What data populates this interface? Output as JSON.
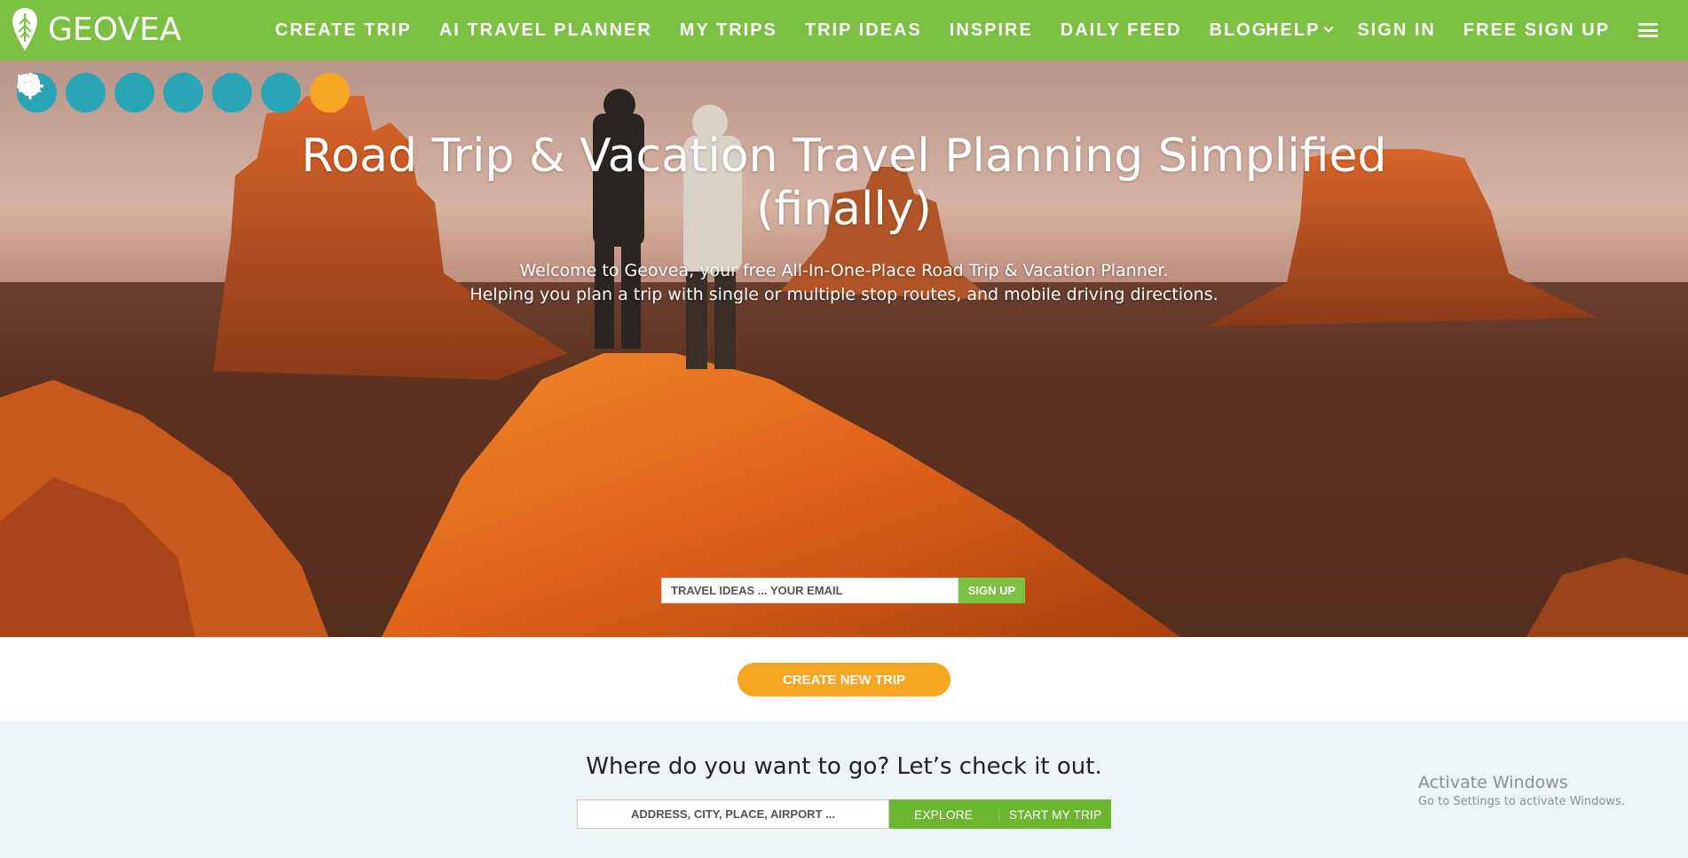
{
  "brand": {
    "name": "GEOVEA",
    "color": "#7cc043"
  },
  "nav": {
    "items": [
      {
        "label": "CREATE TRIP"
      },
      {
        "label": "AI TRAVEL PLANNER"
      },
      {
        "label": "MY TRIPS"
      },
      {
        "label": "TRIP IDEAS"
      },
      {
        "label": "INSPIRE"
      },
      {
        "label": "DAILY FEED"
      },
      {
        "label": "BLOG"
      }
    ],
    "help_label": "HELP",
    "signin_label": "SIGN IN",
    "signup_label": "FREE SIGN UP",
    "menu_icon": "hamburger-icon"
  },
  "categories": [
    {
      "icon": "bed-icon",
      "color": "#2aa5b8"
    },
    {
      "icon": "car-icon",
      "color": "#2aa5b8"
    },
    {
      "icon": "plane-icon",
      "color": "#2aa5b8"
    },
    {
      "icon": "ticket-star-icon",
      "color": "#2aa5b8"
    },
    {
      "icon": "tent-icon",
      "color": "#2aa5b8"
    },
    {
      "icon": "paw-icon",
      "color": "#2aa5b8"
    },
    {
      "icon": "location-target-icon",
      "color": "#f5a623"
    }
  ],
  "hero": {
    "title_line1": "Road Trip & Vacation Travel Planning Simplified",
    "title_line2": "(finally)",
    "subtitle_line1": "Welcome to Geovea, your free All-In-One-Place Road Trip & Vacation Planner.",
    "subtitle_line2": "Helping you plan a trip with single or multiple stop routes, and mobile driving directions.",
    "email_placeholder": "TRAVEL IDEAS ... YOUR EMAIL",
    "email_value": "",
    "signup_button": "SIGN UP"
  },
  "cta": {
    "create_trip_button": "CREATE NEW TRIP",
    "color": "#f5a623"
  },
  "search": {
    "heading": "Where do you want to go? Let’s check it out.",
    "address_placeholder": "ADDRESS, CITY, PLACE, AIRPORT ...",
    "address_value": "",
    "explore_button": "EXPLORE",
    "divider": "|",
    "start_button": "START MY TRIP"
  },
  "watermark": {
    "title": "Activate Windows",
    "subtitle": "Go to Settings to activate Windows."
  }
}
